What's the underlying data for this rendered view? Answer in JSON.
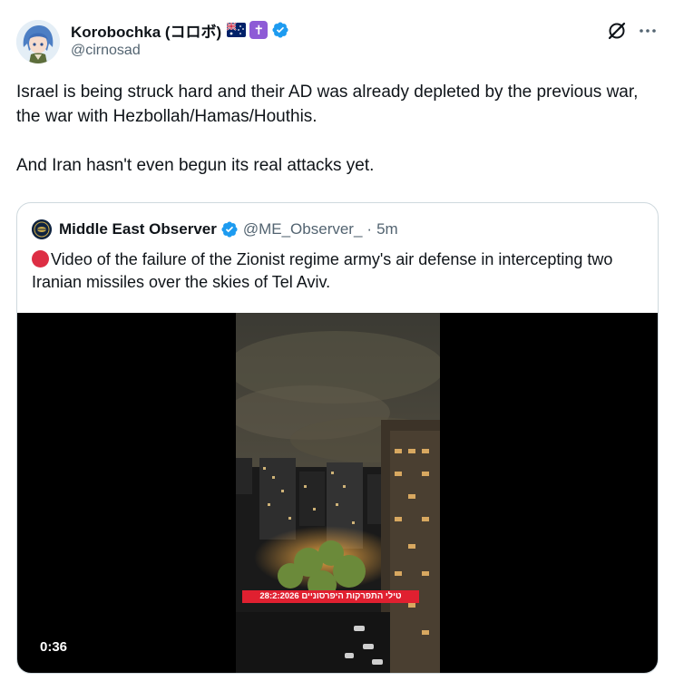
{
  "author": {
    "display_name": "Korobochka (コロボ)",
    "handle": "@cirnosad",
    "badges": [
      "australia-flag-emoji",
      "latin-cross-emoji",
      "verified-badge"
    ],
    "verified_color": "#1d9bf0"
  },
  "header_actions": {
    "grok_icon": "grok-icon",
    "more_icon": "more-icon"
  },
  "tweet": {
    "paragraph_1": "Israel is being struck hard and their AD was already depleted by the previous war, the war with Hezbollah/Hamas/Houthis.",
    "paragraph_2": "And Iran hasn't even begun its real attacks yet."
  },
  "quote": {
    "display_name": "Middle East Observer",
    "handle": "@ME_Observer_",
    "separator": "·",
    "time": "5m",
    "text": "Video of the failure of the Zionist regime army's air defense in intercepting two Iranian missiles over the skies of Tel Aviv.",
    "lead_icon": "red-circle-emoji",
    "video": {
      "caption": "טילי התפרקות היפרסוניים 28:2:2026",
      "duration": "0:36"
    }
  },
  "colors": {
    "text_primary": "#0f1419",
    "text_secondary": "#536471",
    "border": "#cfd9de",
    "verified": "#1d9bf0",
    "caption_red": "#e02030"
  }
}
